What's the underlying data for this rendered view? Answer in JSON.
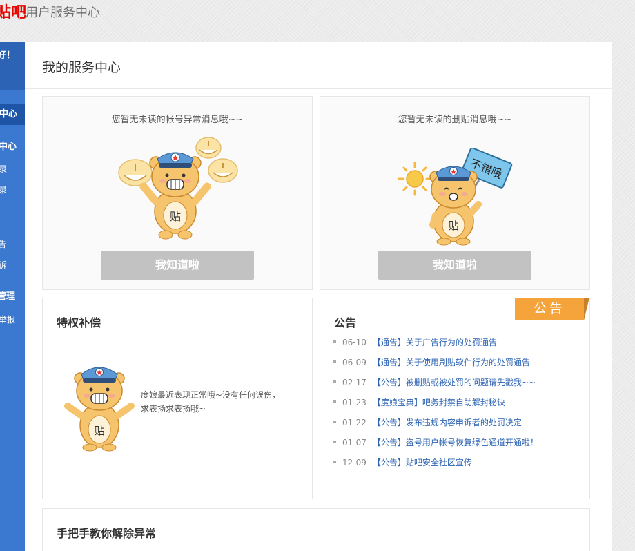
{
  "header": {
    "logo_text": "贴吧",
    "title": "用户服务中心"
  },
  "sidebar": {
    "greeting": "好！",
    "items": [
      {
        "label": "心中心"
      },
      {
        "label": "中心"
      },
      {
        "label": "录"
      },
      {
        "label": "录"
      },
      {
        "label": "告"
      },
      {
        "label": "诉"
      },
      {
        "label": "管理"
      },
      {
        "label": "举报"
      }
    ]
  },
  "main": {
    "title": "我的服务中心"
  },
  "account_card": {
    "message": "您暂无未读的帐号异常消息哦~~",
    "button_label": "我知道啦"
  },
  "delete_card": {
    "message": "您暂无未读的删贴消息哦~~",
    "button_label": "我知道啦",
    "sign_text": "不错哦"
  },
  "compensation": {
    "title": "特权补偿",
    "text_line1": "度娘最近表现正常哦~没有任何误伤，",
    "text_line2": "求表扬求表扬哦~"
  },
  "notice": {
    "title": "公告",
    "ribbon": "公告",
    "items": [
      {
        "date": "06-10",
        "tag": "【通告】",
        "text": "关于广告行为的处罚通告"
      },
      {
        "date": "06-09",
        "tag": "【通告】",
        "text": "关于使用刷贴软件行为的处罚通告"
      },
      {
        "date": "02-17",
        "tag": "【公告】",
        "text": "被删贴或被处罚的问题请先戳我~~"
      },
      {
        "date": "01-23",
        "tag": "【度娘宝典】",
        "text": "吧务封禁自助解封秘诀"
      },
      {
        "date": "01-22",
        "tag": "【公告】",
        "text": "发布违规内容申诉者的处罚决定"
      },
      {
        "date": "01-07",
        "tag": "【公告】",
        "text": "盗号用户帐号恢复绿色通道开通啦！"
      },
      {
        "date": "12-09",
        "tag": "【公告】",
        "text": "贴吧安全社区宣传"
      }
    ]
  },
  "tutorial": {
    "title": "手把手教你解除异常"
  },
  "bear_badge": "贴",
  "colors": {
    "accent_blue": "#3b78d0",
    "brand_red": "#e10601",
    "ribbon_orange": "#f5a43c",
    "button_grey": "#c2c2c2"
  }
}
